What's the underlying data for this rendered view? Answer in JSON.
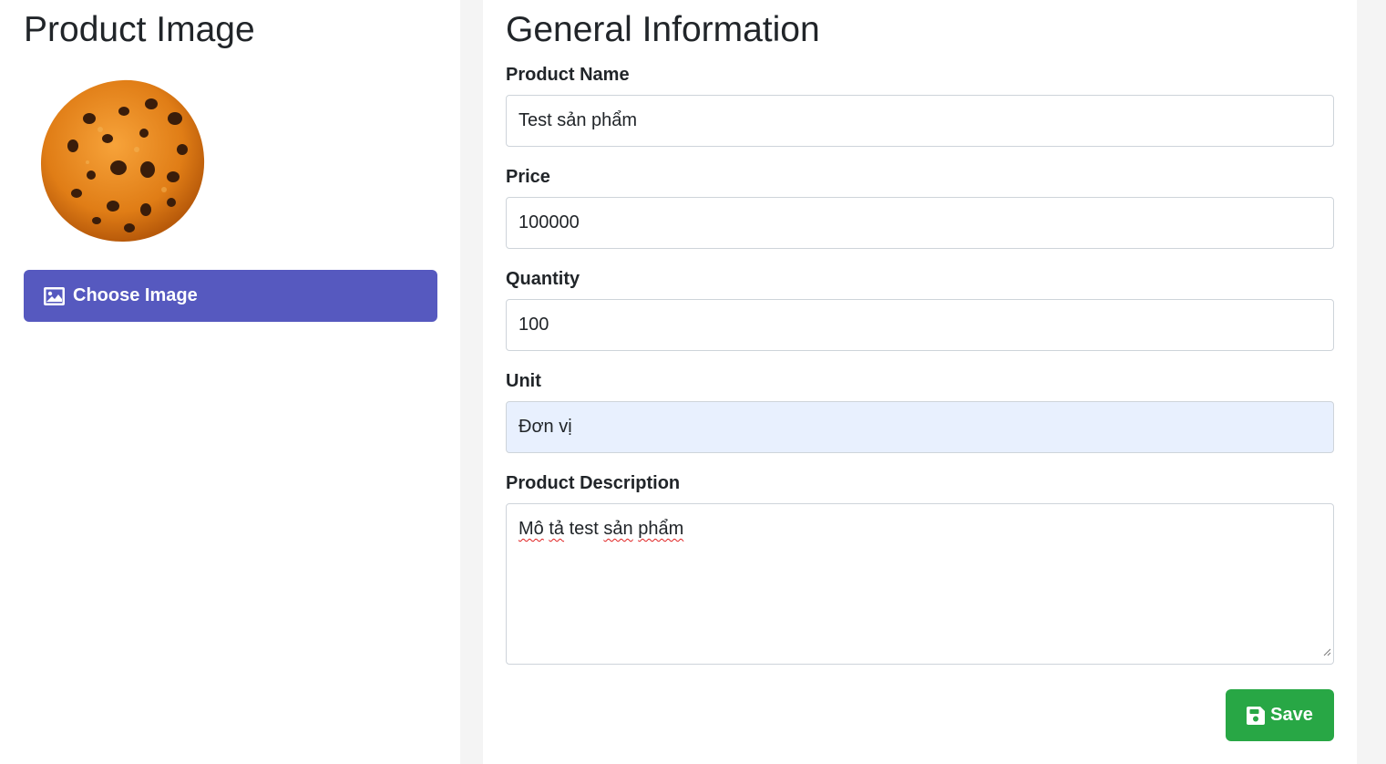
{
  "left_panel": {
    "title": "Product Image",
    "image_alt": "cookie",
    "choose_button_label": "Choose Image"
  },
  "right_panel": {
    "title": "General Information",
    "fields": {
      "name": {
        "label": "Product Name",
        "value": "Test sản phẩm"
      },
      "price": {
        "label": "Price",
        "value": "100000"
      },
      "quantity": {
        "label": "Quantity",
        "value": "100"
      },
      "unit": {
        "label": "Unit",
        "value": "Đơn vị"
      },
      "description": {
        "label": "Product Description",
        "words": [
          "Mô",
          "tả",
          "test",
          "sản",
          "phẩm"
        ]
      }
    },
    "save_button_label": "Save"
  },
  "colors": {
    "primary": "#5659bf",
    "success": "#28a745",
    "autofill_bg": "#e8f0fe"
  },
  "icons": {
    "choose_button": "image-icon",
    "save_button": "floppy-disk-icon"
  }
}
